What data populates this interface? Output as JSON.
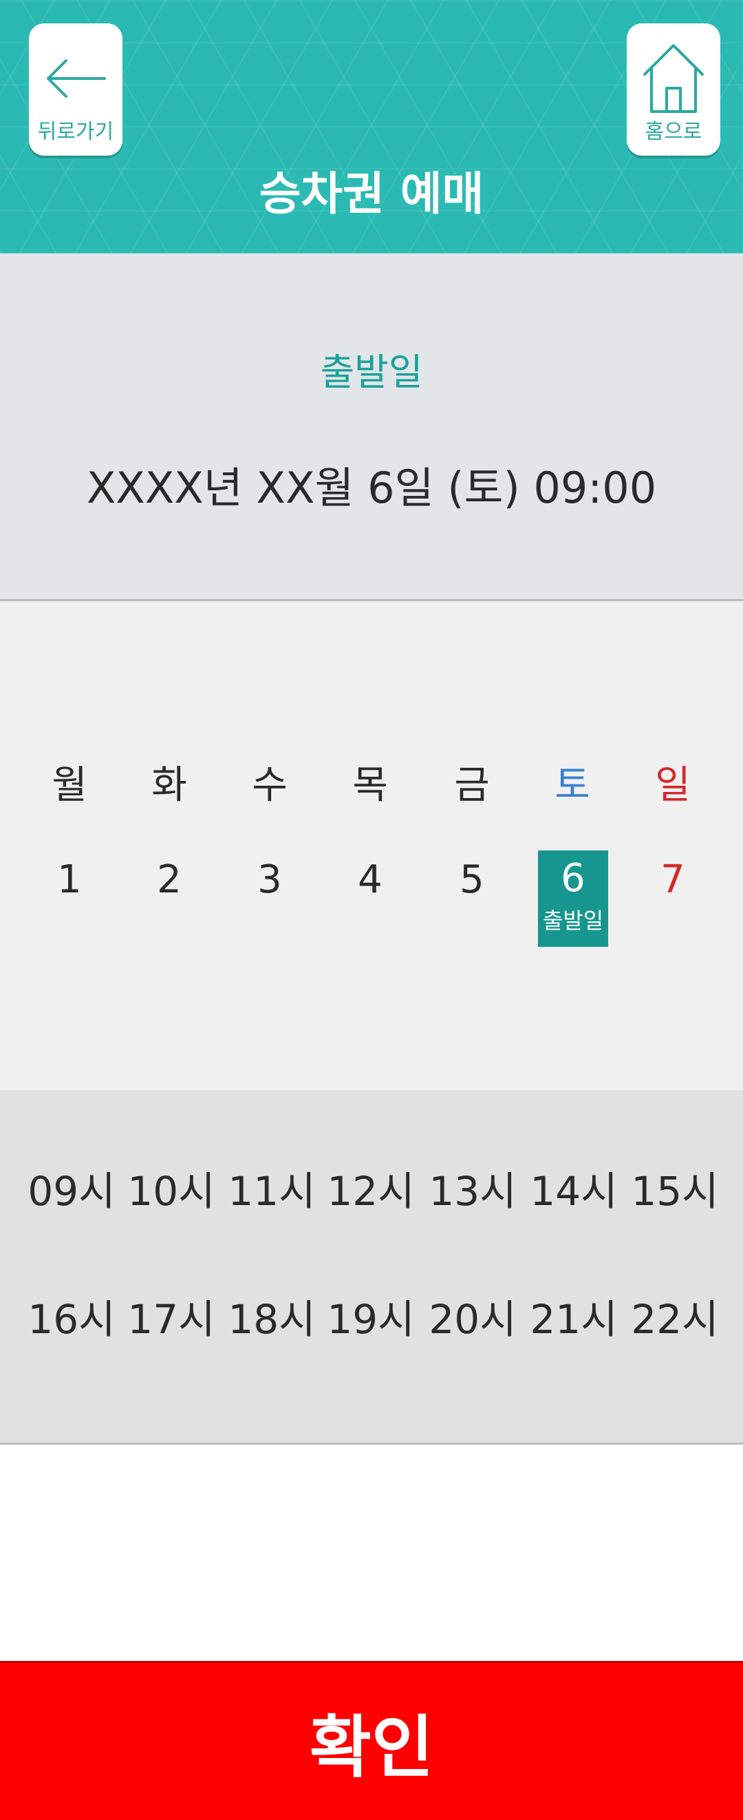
{
  "header": {
    "title": "승차권 예매",
    "back_label": "뒤로가기",
    "home_label": "홈으로",
    "bg_color": "#2bbab3"
  },
  "departure": {
    "label": "출발일",
    "value": "XXXX년 XX월 6일 (토) 09:00"
  },
  "calendar": {
    "weekdays": [
      "월",
      "화",
      "수",
      "목",
      "금",
      "토",
      "일"
    ],
    "days": [
      "1",
      "2",
      "3",
      "4",
      "5",
      "6",
      "7"
    ],
    "selected_day": "6",
    "selected_caption": "출발일",
    "saturday_color": "#3a80d2",
    "sunday_color": "#d32a2a",
    "selected_color": "#16968f"
  },
  "times": {
    "row1": [
      "09시",
      "10시",
      "11시",
      "12시",
      "13시",
      "14시",
      "15시"
    ],
    "row2": [
      "16시",
      "17시",
      "18시",
      "19시",
      "20시",
      "21시",
      "22시"
    ]
  },
  "confirm": {
    "label": "확인",
    "color": "#ff0000"
  },
  "icons": [
    "back-arrow-icon",
    "home-icon"
  ]
}
